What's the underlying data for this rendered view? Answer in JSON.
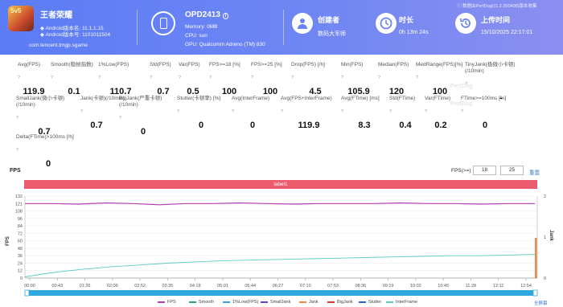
{
  "header": {
    "app": {
      "name": "王者荣耀",
      "icon_text": "5v5",
      "version_line": "Android版本名: 11.1.1.15",
      "code_line": "Android版本号: 1101011504",
      "package": "com.tencent.tmgp.sgame"
    },
    "device": {
      "name": "OPD2413",
      "memory": "Memory: 0MB",
      "cpu": "CPU: sun",
      "gpu": "GPU: Qualcomm Adreno (TM) 830"
    },
    "creator": {
      "label": "创建者",
      "value": "数码大军师"
    },
    "duration": {
      "label": "时长",
      "value": "0h 13m 24s"
    },
    "upload": {
      "label": "上传时间",
      "value": "15/10/2025 22:17:01"
    },
    "notice": "数据由PerfDog(11.2.250408)版本收集",
    "brand_color": "#6a84f4"
  },
  "metrics_row1": [
    {
      "label": "Avg(FPS)",
      "value": "119.9"
    },
    {
      "label": "Smooth(稳帧指数)",
      "value": "0.1"
    },
    {
      "label": "1%Low(FPS)",
      "value": "110.7"
    },
    {
      "label": "Std(FPS)",
      "value": "0.7"
    },
    {
      "label": "Var(FPS)",
      "value": "0.5"
    },
    {
      "label": "FPS>=18 [%]",
      "value": "100"
    },
    {
      "label": "FPS>=25 [%]",
      "value": "100"
    },
    {
      "label": "Drop(FPS) [/h]",
      "value": "4.5"
    },
    {
      "label": "Min(FPS)",
      "value": "105.9"
    },
    {
      "label": "Median(FPS)",
      "value": "120"
    },
    {
      "label": "MedRange(FPS)[%]",
      "value": "100"
    },
    {
      "label": "TinyJank(极微小卡顿)(/10min)",
      "value": "-"
    }
  ],
  "metrics_row2": [
    {
      "label": "SmallJank(微小卡顿)(/10min)",
      "value": "0.7"
    },
    {
      "label": "Jank(卡顿)(/10min)",
      "value": "0.7"
    },
    {
      "label": "BigJank(严重卡顿)(/10min)",
      "value": "0"
    },
    {
      "label": "Stutter(卡顿率) [%]",
      "value": "0"
    },
    {
      "label": "Avg(InterFrame)",
      "value": "0"
    },
    {
      "label": "Avg(FPS+InterFrame)",
      "value": "119.9"
    },
    {
      "label": "Avg(FTime) [ms]",
      "value": "8.3"
    },
    {
      "label": "Std(FTime)",
      "value": "0.4"
    },
    {
      "label": "Var(FTime)",
      "value": "0.2"
    },
    {
      "label": "FTime>=100ms [%]",
      "value": "0"
    }
  ],
  "metrics_row3": [
    {
      "label": "Delta(FTime)>100ms [/h]",
      "value": "0"
    }
  ],
  "watermark": "PerfDog",
  "chart_controls": {
    "title": "FPS",
    "threshold_label": "FPS(>=)",
    "threshold_1": "18",
    "threshold_2": "25",
    "reset_label": "重置",
    "label_bar": "label1",
    "fullscreen_label": "全屏幕"
  },
  "chart_data": {
    "type": "line",
    "ylabel": "FPS",
    "y2label": "Jank",
    "y_ticks": [
      "132",
      "121",
      "108",
      "96",
      "84",
      "72",
      "60",
      "48",
      "36",
      "24",
      "12",
      "0"
    ],
    "y2_ticks": [
      "2",
      "1",
      "0"
    ],
    "x_ticks": [
      "00:00",
      "00:43",
      "01:26",
      "02:09",
      "02:52",
      "03:35",
      "04:18",
      "05:01",
      "05:44",
      "06:27",
      "07:10",
      "07:53",
      "08:36",
      "09:19",
      "10:02",
      "10:45",
      "11:28",
      "12:11",
      "12:54"
    ],
    "ylim": [
      0,
      132
    ],
    "series": [
      {
        "name": "FPS",
        "color": "#b23fb8",
        "values": [
          120,
          120,
          119,
          121,
          120,
          118,
          120,
          120,
          121,
          120,
          119,
          120,
          120,
          120,
          121,
          120,
          120,
          119,
          120,
          120
        ]
      },
      {
        "name": "Smooth",
        "color": "#2aa36b",
        "values": [
          0
        ]
      },
      {
        "name": "1%Low(FPS)",
        "color": "#3f9de0",
        "values": [
          110.7
        ]
      },
      {
        "name": "SmallJank",
        "color": "#6d3fc5",
        "values": [
          0
        ]
      },
      {
        "name": "Jank",
        "color": "#e8894a",
        "values": [
          0
        ]
      },
      {
        "name": "BigJank",
        "color": "#d6382f",
        "values": [
          0
        ]
      },
      {
        "name": "Stutter",
        "color": "#2466c7",
        "values": [
          0
        ]
      },
      {
        "name": "InterFrame",
        "color": "#5ecbc3",
        "values": [
          2,
          9,
          14,
          18,
          21,
          24,
          26,
          28,
          29,
          30,
          31,
          32,
          33,
          34,
          35,
          36,
          36,
          37,
          38
        ]
      }
    ]
  }
}
